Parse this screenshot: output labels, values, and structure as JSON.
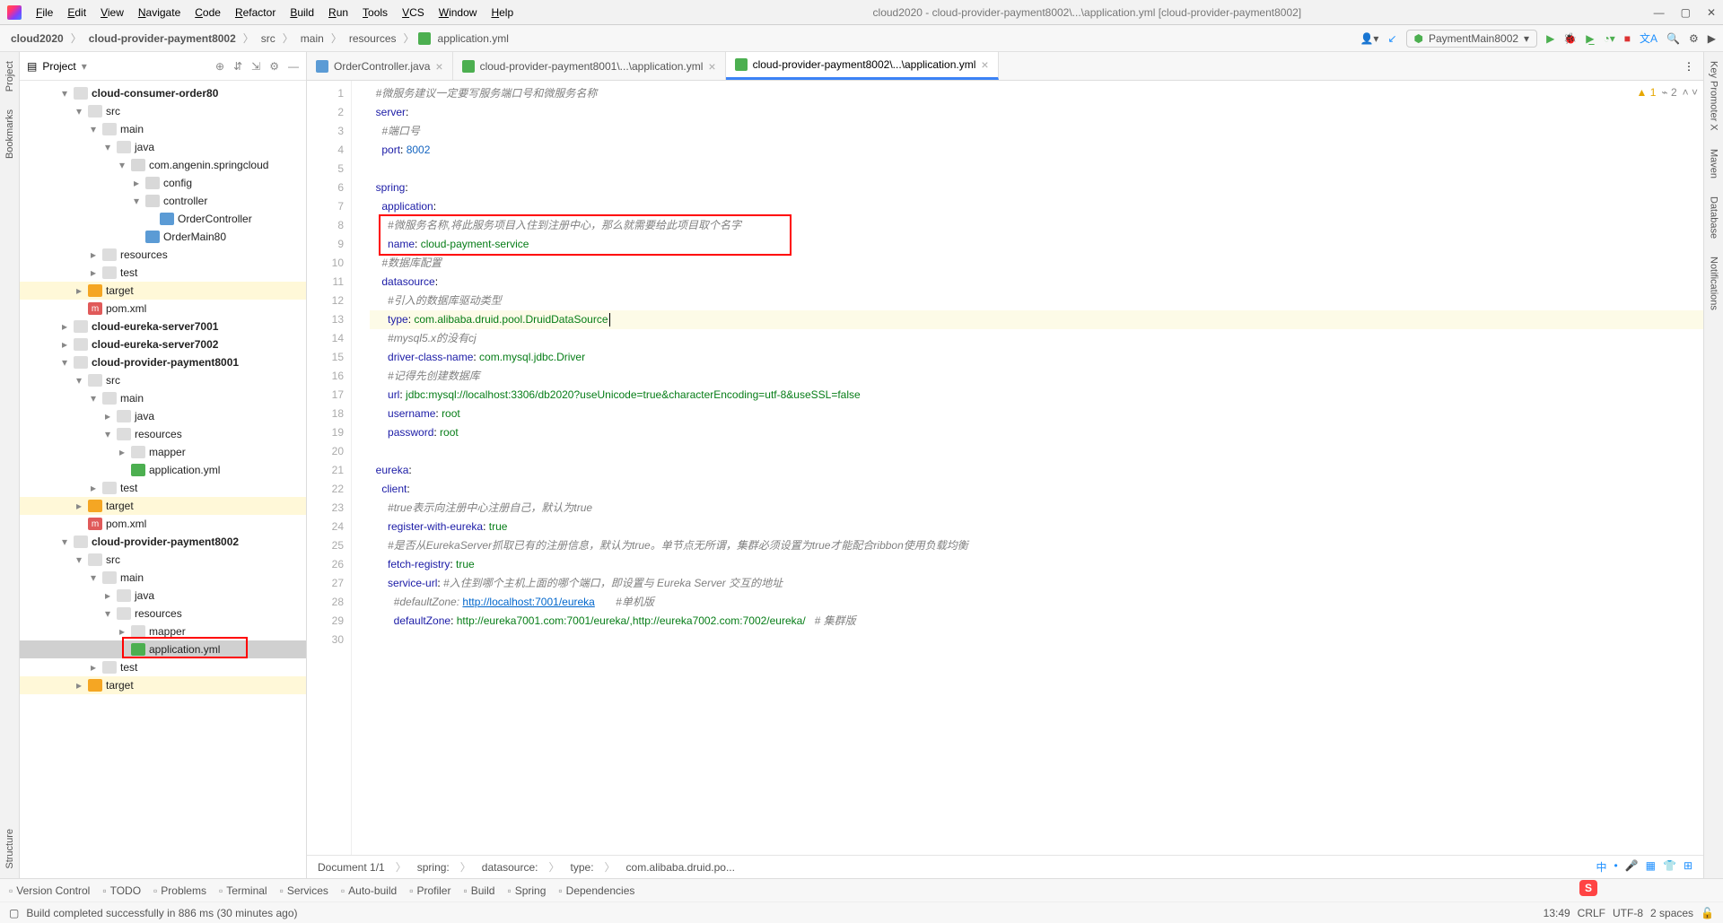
{
  "menu": {
    "items": [
      "File",
      "Edit",
      "View",
      "Navigate",
      "Code",
      "Refactor",
      "Build",
      "Run",
      "Tools",
      "VCS",
      "Window",
      "Help"
    ]
  },
  "window_title": "cloud2020 - cloud-provider-payment8002\\...\\application.yml [cloud-provider-payment8002]",
  "breadcrumb": [
    "cloud2020",
    "cloud-provider-payment8002",
    "src",
    "main",
    "resources",
    "application.yml"
  ],
  "run_config": "PaymentMain8002",
  "sidebar": {
    "title": "Project"
  },
  "tree": [
    {
      "d": 0,
      "tw": "▾",
      "ico": "folder",
      "lbl": "cloud-consumer-order80",
      "bold": true
    },
    {
      "d": 1,
      "tw": "▾",
      "ico": "folder",
      "lbl": "src"
    },
    {
      "d": 2,
      "tw": "▾",
      "ico": "folder",
      "lbl": "main"
    },
    {
      "d": 3,
      "tw": "▾",
      "ico": "folder",
      "lbl": "java"
    },
    {
      "d": 4,
      "tw": "▾",
      "ico": "pkg",
      "lbl": "com.angenin.springcloud"
    },
    {
      "d": 5,
      "tw": "▸",
      "ico": "pkg",
      "lbl": "config"
    },
    {
      "d": 5,
      "tw": "▾",
      "ico": "pkg",
      "lbl": "controller"
    },
    {
      "d": 6,
      "tw": "",
      "ico": "java",
      "lbl": "OrderController"
    },
    {
      "d": 5,
      "tw": "",
      "ico": "java",
      "lbl": "OrderMain80"
    },
    {
      "d": 2,
      "tw": "▸",
      "ico": "folder",
      "lbl": "resources"
    },
    {
      "d": 2,
      "tw": "▸",
      "ico": "folder",
      "lbl": "test"
    },
    {
      "d": 1,
      "tw": "▸",
      "ico": "folder-orange",
      "lbl": "target",
      "hl": true
    },
    {
      "d": 1,
      "tw": "",
      "ico": "maven",
      "lbl": "pom.xml"
    },
    {
      "d": 0,
      "tw": "▸",
      "ico": "folder",
      "lbl": "cloud-eureka-server7001",
      "bold": true
    },
    {
      "d": 0,
      "tw": "▸",
      "ico": "folder",
      "lbl": "cloud-eureka-server7002",
      "bold": true
    },
    {
      "d": 0,
      "tw": "▾",
      "ico": "folder",
      "lbl": "cloud-provider-payment8001",
      "bold": true
    },
    {
      "d": 1,
      "tw": "▾",
      "ico": "folder",
      "lbl": "src"
    },
    {
      "d": 2,
      "tw": "▾",
      "ico": "folder",
      "lbl": "main"
    },
    {
      "d": 3,
      "tw": "▸",
      "ico": "folder",
      "lbl": "java"
    },
    {
      "d": 3,
      "tw": "▾",
      "ico": "folder",
      "lbl": "resources"
    },
    {
      "d": 4,
      "tw": "▸",
      "ico": "folder",
      "lbl": "mapper"
    },
    {
      "d": 4,
      "tw": "",
      "ico": "yaml",
      "lbl": "application.yml"
    },
    {
      "d": 2,
      "tw": "▸",
      "ico": "folder",
      "lbl": "test"
    },
    {
      "d": 1,
      "tw": "▸",
      "ico": "folder-orange",
      "lbl": "target",
      "hl": true
    },
    {
      "d": 1,
      "tw": "",
      "ico": "maven",
      "lbl": "pom.xml"
    },
    {
      "d": 0,
      "tw": "▾",
      "ico": "folder",
      "lbl": "cloud-provider-payment8002",
      "bold": true
    },
    {
      "d": 1,
      "tw": "▾",
      "ico": "folder",
      "lbl": "src"
    },
    {
      "d": 2,
      "tw": "▾",
      "ico": "folder",
      "lbl": "main"
    },
    {
      "d": 3,
      "tw": "▸",
      "ico": "folder",
      "lbl": "java"
    },
    {
      "d": 3,
      "tw": "▾",
      "ico": "folder",
      "lbl": "resources"
    },
    {
      "d": 4,
      "tw": "▸",
      "ico": "folder",
      "lbl": "mapper"
    },
    {
      "d": 4,
      "tw": "",
      "ico": "yaml",
      "lbl": "application.yml",
      "sel": true,
      "redbox": true
    },
    {
      "d": 2,
      "tw": "▸",
      "ico": "folder",
      "lbl": "test"
    },
    {
      "d": 1,
      "tw": "▸",
      "ico": "folder-orange",
      "lbl": "target",
      "hl": true
    }
  ],
  "tabs": [
    {
      "ico": "java",
      "label": "OrderController.java"
    },
    {
      "ico": "yaml",
      "label": "cloud-provider-payment8001\\...\\application.yml"
    },
    {
      "ico": "yaml",
      "label": "cloud-provider-payment8002\\...\\application.yml",
      "active": true
    }
  ],
  "code_lines": [
    {
      "n": 1,
      "seg": [
        {
          "t": "#微服务建议一定要写服务端口号和微服务名称",
          "c": "cmt"
        }
      ],
      "i": 1
    },
    {
      "n": 2,
      "seg": [
        {
          "t": "server",
          "c": "key"
        },
        {
          "t": ":"
        }
      ],
      "i": 1
    },
    {
      "n": 3,
      "seg": [
        {
          "t": "#端口号",
          "c": "cmt"
        }
      ],
      "i": 2
    },
    {
      "n": 4,
      "seg": [
        {
          "t": "port",
          "c": "key"
        },
        {
          "t": ": "
        },
        {
          "t": "8002",
          "c": "num"
        }
      ],
      "i": 2
    },
    {
      "n": 5,
      "seg": [],
      "i": 0
    },
    {
      "n": 6,
      "seg": [
        {
          "t": "spring",
          "c": "key"
        },
        {
          "t": ":"
        }
      ],
      "i": 1
    },
    {
      "n": 7,
      "seg": [
        {
          "t": "application",
          "c": "key"
        },
        {
          "t": ":"
        }
      ],
      "i": 2
    },
    {
      "n": 8,
      "seg": [
        {
          "t": "#微服务名称,将此服务项目入住到注册中心，那么就需要给此项目取个名字",
          "c": "cmt"
        }
      ],
      "i": 3,
      "redtop": true
    },
    {
      "n": 9,
      "seg": [
        {
          "t": "name",
          "c": "key"
        },
        {
          "t": ": "
        },
        {
          "t": "cloud-payment-service",
          "c": "str"
        }
      ],
      "i": 3,
      "redbot": true
    },
    {
      "n": 10,
      "seg": [
        {
          "t": "#数据库配置",
          "c": "cmt"
        }
      ],
      "i": 2
    },
    {
      "n": 11,
      "seg": [
        {
          "t": "datasource",
          "c": "key"
        },
        {
          "t": ":"
        }
      ],
      "i": 2
    },
    {
      "n": 12,
      "seg": [
        {
          "t": "#引入的数据库驱动类型",
          "c": "cmt"
        }
      ],
      "i": 3
    },
    {
      "n": 13,
      "seg": [
        {
          "t": "type",
          "c": "key"
        },
        {
          "t": ": "
        },
        {
          "t": "com.alibaba.druid.pool.DruidDataSource",
          "c": "str"
        }
      ],
      "i": 3,
      "hl": true,
      "cursor": true
    },
    {
      "n": 14,
      "seg": [
        {
          "t": "#mysql5.x的没有cj",
          "c": "cmt"
        }
      ],
      "i": 3
    },
    {
      "n": 15,
      "seg": [
        {
          "t": "driver-class-name",
          "c": "key"
        },
        {
          "t": ": "
        },
        {
          "t": "com.mysql.jdbc.Driver",
          "c": "str"
        }
      ],
      "i": 3
    },
    {
      "n": 16,
      "seg": [
        {
          "t": "#记得先创建数据库",
          "c": "cmt"
        }
      ],
      "i": 3
    },
    {
      "n": 17,
      "seg": [
        {
          "t": "url",
          "c": "key"
        },
        {
          "t": ": "
        },
        {
          "t": "jdbc:mysql://localhost:3306/db2020?useUnicode=true&characterEncoding=utf-8&useSSL=false",
          "c": "str"
        }
      ],
      "i": 3
    },
    {
      "n": 18,
      "seg": [
        {
          "t": "username",
          "c": "key"
        },
        {
          "t": ": "
        },
        {
          "t": "root",
          "c": "str"
        }
      ],
      "i": 3
    },
    {
      "n": 19,
      "seg": [
        {
          "t": "password",
          "c": "key"
        },
        {
          "t": ": "
        },
        {
          "t": "root",
          "c": "str"
        }
      ],
      "i": 3
    },
    {
      "n": 20,
      "seg": [],
      "i": 0
    },
    {
      "n": 21,
      "seg": [
        {
          "t": "eureka",
          "c": "key"
        },
        {
          "t": ":"
        }
      ],
      "i": 1
    },
    {
      "n": 22,
      "seg": [
        {
          "t": "client",
          "c": "key"
        },
        {
          "t": ":"
        }
      ],
      "i": 2
    },
    {
      "n": 23,
      "seg": [
        {
          "t": "#true表示向注册中心注册自己，默认为true",
          "c": "cmt"
        }
      ],
      "i": 3
    },
    {
      "n": 24,
      "seg": [
        {
          "t": "register-with-eureka",
          "c": "key"
        },
        {
          "t": ": "
        },
        {
          "t": "true",
          "c": "str"
        }
      ],
      "i": 3
    },
    {
      "n": 25,
      "seg": [
        {
          "t": "#是否从EurekaServer抓取已有的注册信息，默认为true。单节点无所谓，集群必须设置为true才能配合ribbon使用负载均衡",
          "c": "cmt"
        }
      ],
      "i": 3
    },
    {
      "n": 26,
      "seg": [
        {
          "t": "fetch-registry",
          "c": "key"
        },
        {
          "t": ": "
        },
        {
          "t": "true",
          "c": "str"
        }
      ],
      "i": 3
    },
    {
      "n": 27,
      "seg": [
        {
          "t": "service-url",
          "c": "key"
        },
        {
          "t": ": "
        },
        {
          "t": "#入住到哪个主机上面的哪个端口，即设置与 Eureka Server 交互的地址",
          "c": "cmt"
        }
      ],
      "i": 3
    },
    {
      "n": 28,
      "seg": [
        {
          "t": "#defaultZone: ",
          "c": "cmt"
        },
        {
          "t": "http://localhost:7001/eureka",
          "c": "url"
        },
        {
          "t": "       #单机版",
          "c": "cmt"
        }
      ],
      "i": 4
    },
    {
      "n": 29,
      "seg": [
        {
          "t": "defaultZone",
          "c": "key"
        },
        {
          "t": ": "
        },
        {
          "t": "http://eureka7001.com:7001/eureka/,http://eureka7002.com:7002/eureka/",
          "c": "str"
        },
        {
          "t": "   # 集群版",
          "c": "cmt"
        }
      ],
      "i": 4
    },
    {
      "n": 30,
      "seg": [],
      "i": 0
    }
  ],
  "inspections": {
    "warn": "1",
    "weak": "2"
  },
  "bottom_crumb": [
    "Document 1/1",
    "spring:",
    "datasource:",
    "type:",
    "com.alibaba.druid.po..."
  ],
  "tool_windows": [
    "Version Control",
    "TODO",
    "Problems",
    "Terminal",
    "Services",
    "Auto-build",
    "Profiler",
    "Build",
    "Spring",
    "Dependencies"
  ],
  "build_msg": "Build completed successfully in 886 ms (30 minutes ago)",
  "status_right": {
    "pos": "13:49",
    "enc": "CRLF",
    "enc2": "UTF-8",
    "indent": "2 spaces"
  },
  "ime": "S"
}
